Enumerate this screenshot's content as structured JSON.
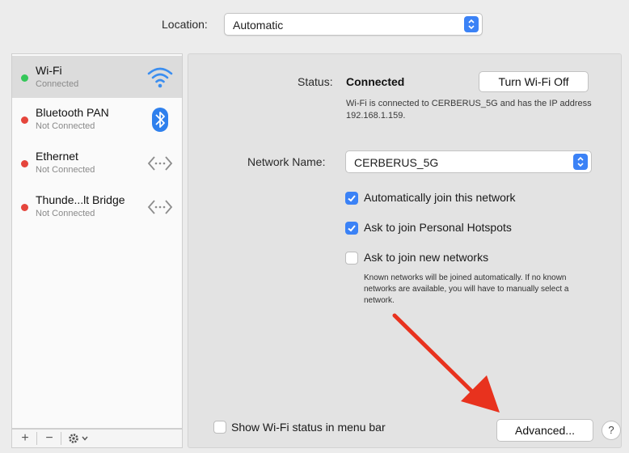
{
  "location": {
    "label": "Location:",
    "value": "Automatic"
  },
  "services": [
    {
      "name": "Wi-Fi",
      "status": "Connected",
      "dot_color": "#34c759",
      "icon": "wifi-icon",
      "selected": true
    },
    {
      "name": "Bluetooth PAN",
      "status": "Not Connected",
      "dot_color": "#e5453c",
      "icon": "bluetooth-icon"
    },
    {
      "name": "Ethernet",
      "status": "Not Connected",
      "dot_color": "#e5453c",
      "icon": "ethernet-icon"
    },
    {
      "name": "Thunde...lt Bridge",
      "status": "Not Connected",
      "dot_color": "#e5453c",
      "icon": "thunderbolt-bridge-icon"
    }
  ],
  "toolbar": {
    "add": "+",
    "remove": "−",
    "actions": "gear-icon"
  },
  "status": {
    "label": "Status:",
    "value": "Connected",
    "button": "Turn Wi-Fi Off",
    "description": "Wi-Fi is connected to CERBERUS_5G and has the IP address 192.168.1.159."
  },
  "network": {
    "label": "Network Name:",
    "value": "CERBERUS_5G"
  },
  "options": [
    {
      "label": "Automatically join this network",
      "checked": true
    },
    {
      "label": "Ask to join Personal Hotspots",
      "checked": true
    },
    {
      "label": "Ask to join new networks",
      "checked": false
    }
  ],
  "known_networks_note": "Known networks will be joined automatically. If no known networks are available, you will have to manually select a network.",
  "footer": {
    "show_status_label": "Show Wi-Fi status in menu bar",
    "show_status_checked": false,
    "advanced_button": "Advanced...",
    "help_button": "?"
  },
  "colors": {
    "accent": "#3b82f6",
    "connected": "#34c759",
    "disconnected": "#e5453c",
    "annotation_arrow": "#e8321e"
  }
}
